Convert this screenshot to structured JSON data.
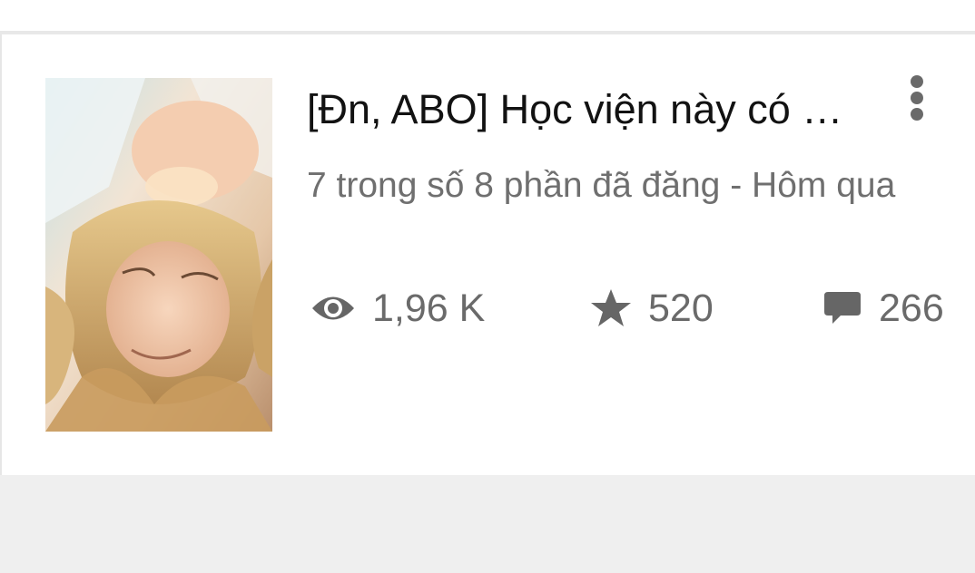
{
  "story": {
    "title": "[Đn, ABO] Học viện này có …",
    "subtitle": "7 trong số 8 phần đã đăng - Hôm qua",
    "cover_icon": "book-cover-illustration",
    "stats": {
      "views": {
        "icon": "eye-icon",
        "value": "1,96 K"
      },
      "votes": {
        "icon": "star-icon",
        "value": "520"
      },
      "comments": {
        "icon": "comment-bubble-icon",
        "value": "266"
      }
    },
    "menu_icon": "more-vertical-icon"
  },
  "colors": {
    "title": "#121212",
    "secondary_text": "#6f6f6f",
    "icon": "#666666",
    "card_background": "#ffffff",
    "page_background": "#efefef"
  }
}
